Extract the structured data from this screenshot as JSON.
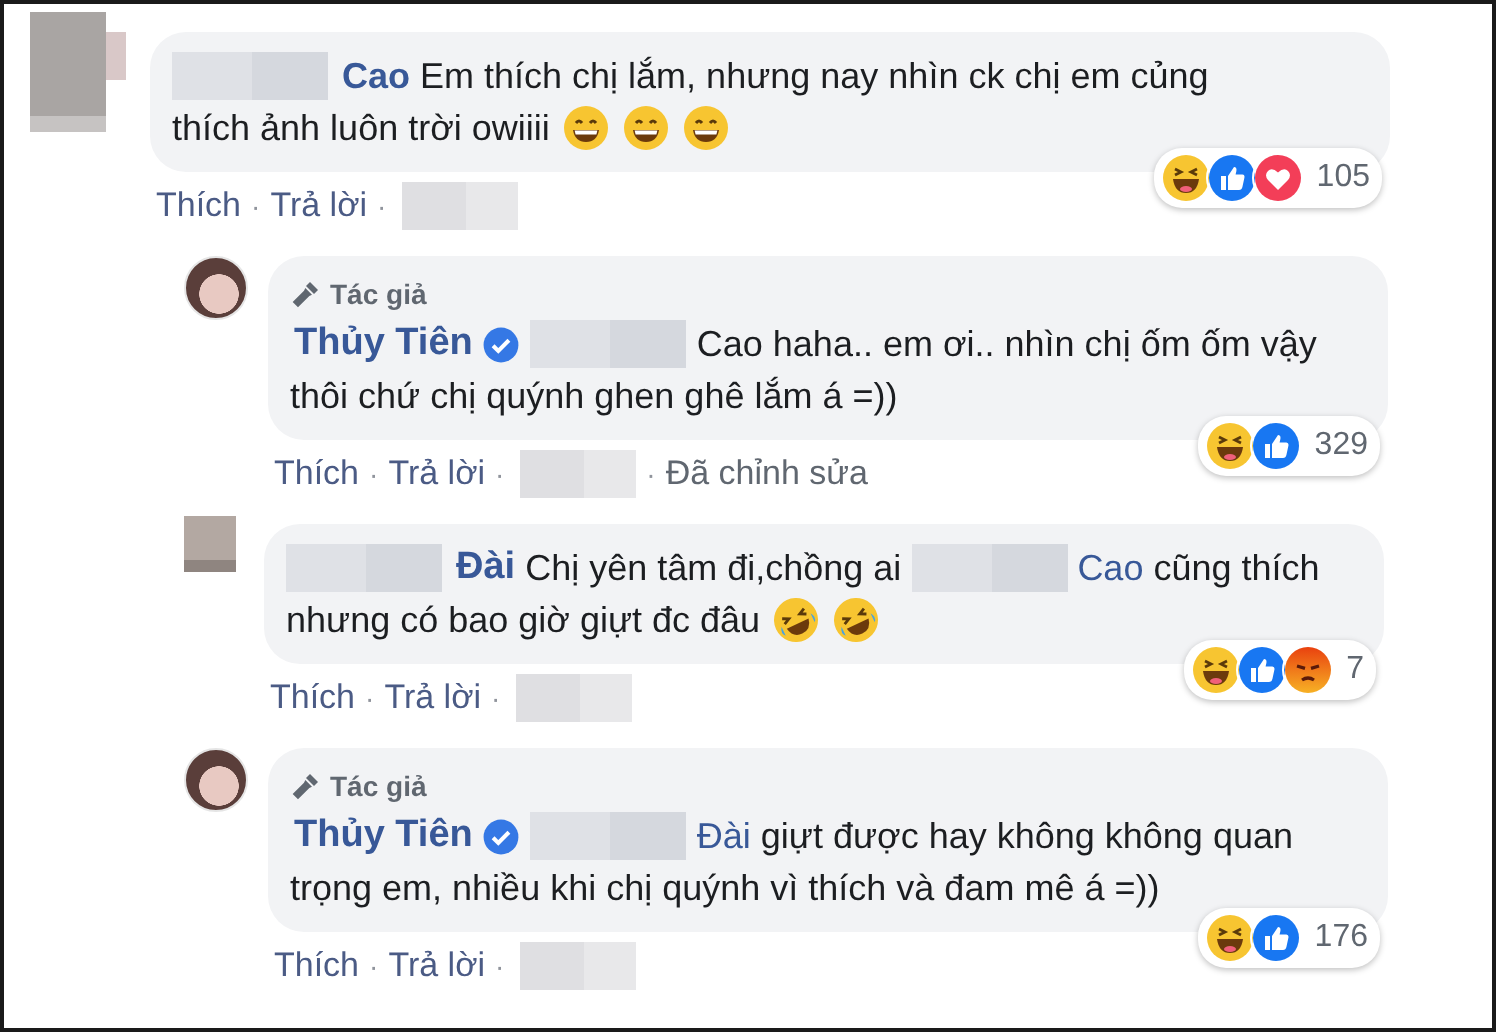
{
  "comments": [
    {
      "avatar": {
        "kind": "pixelated"
      },
      "lines": [
        [
          {
            "kind": "blur"
          },
          {
            "kind": "name",
            "text": "Cao"
          },
          {
            "kind": "text",
            "text": "Em thích chị lắm, nhưng nay nhìn ck chị em củng"
          }
        ],
        [
          {
            "kind": "text",
            "text": "thích ảnh luôn trời owiiii"
          },
          {
            "kind": "grin"
          },
          {
            "kind": "grin"
          },
          {
            "kind": "grin"
          }
        ]
      ],
      "reactions": {
        "icons": [
          {
            "kind": "haha"
          },
          {
            "kind": "like"
          },
          {
            "kind": "love"
          }
        ],
        "count": "105"
      },
      "actions": [
        {
          "kind": "link",
          "text": "Thích"
        },
        {
          "kind": "dot",
          "text": "·"
        },
        {
          "kind": "link",
          "text": "Trả lời"
        },
        {
          "kind": "dot",
          "text": "·"
        },
        {
          "kind": "blur"
        }
      ],
      "children": [
        {
          "avatar": {
            "kind": "photo"
          },
          "author_badge": "Tác giả",
          "lines": [
            [
              {
                "kind": "name",
                "text": "Thủy Tiên"
              },
              {
                "kind": "verified"
              },
              {
                "kind": "blur"
              },
              {
                "kind": "text",
                "text": "Cao haha.. em ơi.. nhìn chị ốm ốm vậy"
              }
            ],
            [
              {
                "kind": "text",
                "text": "thôi chứ chị quýnh ghen ghê lắm á =))"
              }
            ]
          ],
          "reactions": {
            "icons": [
              {
                "kind": "haha"
              },
              {
                "kind": "like"
              }
            ],
            "count": "329"
          },
          "actions": [
            {
              "kind": "link",
              "text": "Thích"
            },
            {
              "kind": "dot",
              "text": "·"
            },
            {
              "kind": "link",
              "text": "Trả lời"
            },
            {
              "kind": "dot",
              "text": "·"
            },
            {
              "kind": "blur"
            },
            {
              "kind": "dot",
              "text": "·"
            },
            {
              "kind": "note",
              "text": "Đã chỉnh sửa"
            }
          ]
        },
        {
          "avatar": {
            "kind": "pixelated"
          },
          "lines": [
            [
              {
                "kind": "blur"
              },
              {
                "kind": "name",
                "text": "Đài"
              },
              {
                "kind": "text",
                "text": "Chị yên tâm đi,chồng ai"
              },
              {
                "kind": "blur"
              },
              {
                "kind": "mention",
                "text": "Cao"
              },
              {
                "kind": "text",
                "text": "cũng thích"
              }
            ],
            [
              {
                "kind": "text",
                "text": "nhưng có bao giờ giựt đc đâu"
              },
              {
                "kind": "rofl"
              },
              {
                "kind": "rofl"
              }
            ]
          ],
          "reactions": {
            "icons": [
              {
                "kind": "haha"
              },
              {
                "kind": "like"
              },
              {
                "kind": "angry"
              }
            ],
            "count": "7"
          },
          "actions": [
            {
              "kind": "link",
              "text": "Thích"
            },
            {
              "kind": "dot",
              "text": "·"
            },
            {
              "kind": "link",
              "text": "Trả lời"
            },
            {
              "kind": "dot",
              "text": "·"
            },
            {
              "kind": "blur"
            }
          ]
        },
        {
          "avatar": {
            "kind": "photo"
          },
          "author_badge": "Tác giả",
          "lines": [
            [
              {
                "kind": "name",
                "text": "Thủy Tiên"
              },
              {
                "kind": "verified"
              },
              {
                "kind": "blur"
              },
              {
                "kind": "mention",
                "text": "Đài"
              },
              {
                "kind": "text",
                "text": "giựt được hay không không quan"
              }
            ],
            [
              {
                "kind": "text",
                "text": "trọng em, nhiều khi chị quýnh vì thích và đam mê á =))"
              }
            ]
          ],
          "reactions": {
            "icons": [
              {
                "kind": "haha"
              },
              {
                "kind": "like"
              }
            ],
            "count": "176"
          },
          "actions": [
            {
              "kind": "link",
              "text": "Thích"
            },
            {
              "kind": "dot",
              "text": "·"
            },
            {
              "kind": "link",
              "text": "Trả lời"
            },
            {
              "kind": "dot",
              "text": "·"
            },
            {
              "kind": "blur"
            }
          ]
        }
      ]
    }
  ]
}
